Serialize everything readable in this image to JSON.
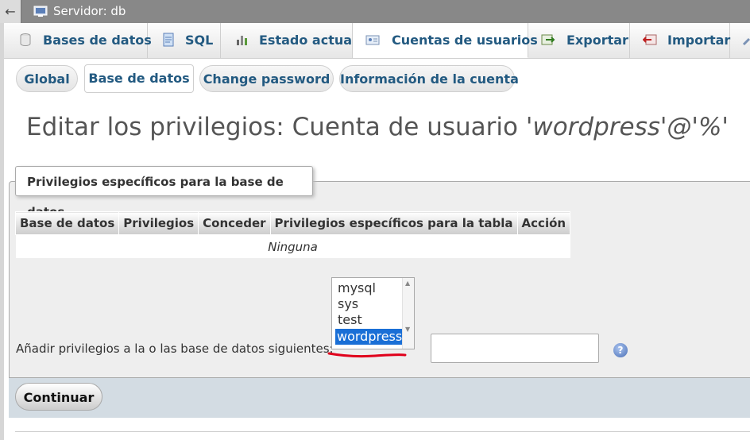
{
  "server_bar": {
    "back_glyph": "←",
    "title": "Servidor: db",
    "icon": "server-icon"
  },
  "main_tabs": [
    {
      "label": "Bases de datos",
      "icon": "database-icon"
    },
    {
      "label": "SQL",
      "icon": "sql-icon"
    },
    {
      "label": "Estado actual",
      "icon": "status-chart-icon"
    },
    {
      "label": "Cuentas de usuarios",
      "icon": "user-card-icon",
      "active": true
    },
    {
      "label": "Exportar",
      "icon": "export-icon"
    },
    {
      "label": "Importar",
      "icon": "import-icon"
    }
  ],
  "sub_tabs": [
    {
      "label": "Global"
    },
    {
      "label": "Base de datos",
      "active": true
    },
    {
      "label": "Change password"
    },
    {
      "label": "Información de la cuenta"
    }
  ],
  "page_title": {
    "prefix": "Editar los privilegios: Cuenta de usuario ",
    "account": "'wordpress'@'%'"
  },
  "fieldset": {
    "legend": "Privilegios específicos para la base de datos",
    "table": {
      "headers": [
        "Base de datos",
        "Privilegios",
        "Conceder",
        "Privilegios específicos para la tabla",
        "Acción"
      ],
      "empty_text": "Ninguna"
    },
    "add_label": "Añadir privilegios a la o las base de datos siguientes:",
    "databases": [
      "mysql",
      "sys",
      "test",
      "wordpress"
    ],
    "selected_database": "wordpress",
    "text_input_value": "",
    "help_icon": "help-icon"
  },
  "submit_label": "Continuar",
  "colors": {
    "link": "#235a81",
    "selection": "#1a6fd6",
    "annotation": "#e0001b"
  }
}
